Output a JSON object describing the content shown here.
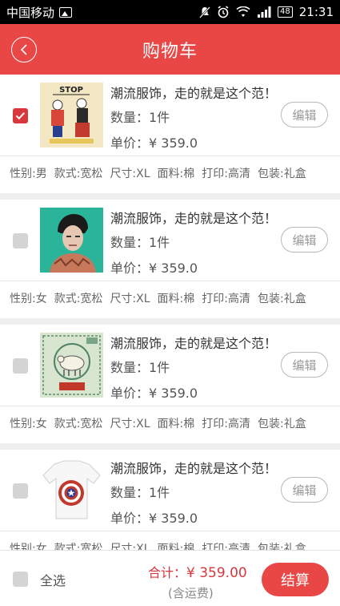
{
  "status_bar": {
    "carrier": "中国移动",
    "time": "21:31",
    "battery": "48"
  },
  "header": {
    "title": "购物车"
  },
  "items": [
    {
      "checked": true,
      "name": "潮流服饰，走的就是这个范！",
      "qty": "数量：1件",
      "price": "单价：¥ 359.0",
      "edit": "编辑",
      "attrs": [
        "性别:男",
        "款式:宽松",
        "尺寸:XL",
        "面料:棉",
        "打印:高清",
        "包装:礼盒"
      ],
      "image": "popeye-stop-tshirt",
      "image_text": "STOP"
    },
    {
      "checked": false,
      "name": "潮流服饰，走的就是这个范！",
      "qty": "数量：1件",
      "price": "单价：¥ 359.0",
      "edit": "编辑",
      "attrs": [
        "性别:女",
        "款式:宽松",
        "尺寸:XL",
        "面料:棉",
        "打印:高清",
        "包装:礼盒"
      ],
      "image": "portrait-tshirt"
    },
    {
      "checked": false,
      "name": "潮流服饰，走的就是这个范！",
      "qty": "数量：1件",
      "price": "单价：¥ 359.0",
      "edit": "编辑",
      "attrs": [
        "性别:女",
        "款式:宽松",
        "尺寸:XL",
        "面料:棉",
        "打印:高清",
        "包装:礼盒"
      ],
      "image": "stamp-sheep-tshirt"
    },
    {
      "checked": false,
      "name": "潮流服饰，走的就是这个范！",
      "qty": "数量：1件",
      "price": "单价：¥ 359.0",
      "edit": "编辑",
      "attrs": [
        "性别:女",
        "款式:宽松",
        "尺寸:XL",
        "面料:棉",
        "打印:高清",
        "包装:礼盒"
      ],
      "image": "captain-shield-tshirt"
    }
  ],
  "footer": {
    "select_all": "全选",
    "total_label": "合计：",
    "total_amount": "¥ 359.00",
    "shipping_note": "(含运费)",
    "checkout": "结算"
  },
  "colors": {
    "accent": "#e94646",
    "checked": "#d7373d"
  }
}
